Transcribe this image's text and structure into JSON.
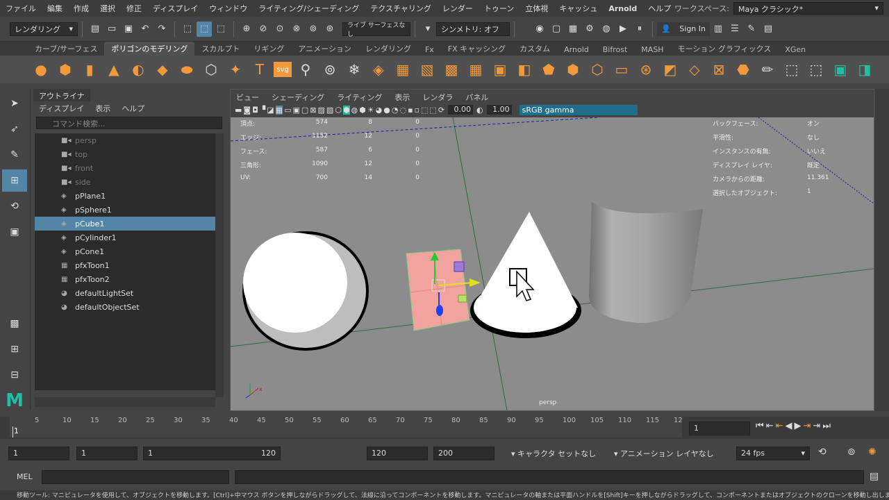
{
  "menubar": {
    "items": [
      "ファイル",
      "編集",
      "作成",
      "選択",
      "修正",
      "ディスプレイ",
      "ウィンドウ",
      "ライティング/シェーディング",
      "テクスチャリング",
      "レンダー",
      "トゥーン",
      "立体視",
      "キャッシュ",
      "Arnold",
      "ヘルプ"
    ],
    "workspace_label": "ワークスペース:",
    "workspace_value": "Maya クラシック*"
  },
  "statusline": {
    "mode": "レンダリング",
    "live_surface": "ライブ サーフェスなし",
    "symmetry": "シンメトリ: オフ",
    "sign_in": "Sign In"
  },
  "shelf": {
    "tabs": [
      "カーブ/サーフェス",
      "ポリゴンのモデリング",
      "スカルプト",
      "リギング",
      "アニメーション",
      "レンダリング",
      "Fx",
      "FX キャッシング",
      "カスタム",
      "Arnold",
      "Bifrost",
      "MASH",
      "モーション グラフィックス",
      "XGen"
    ],
    "active_tab": "ポリゴンのモデリング",
    "svg_label": "svg"
  },
  "outliner": {
    "title": "アウトライナ",
    "menu": [
      "ディスプレイ",
      "表示",
      "ヘルプ"
    ],
    "search_placeholder": "コマンド検索...",
    "items": [
      {
        "label": "persp",
        "icon": "camera-icon",
        "dim": true
      },
      {
        "label": "top",
        "icon": "camera-icon",
        "dim": true
      },
      {
        "label": "front",
        "icon": "camera-icon",
        "dim": true
      },
      {
        "label": "side",
        "icon": "camera-icon",
        "dim": true
      },
      {
        "label": "pPlane1",
        "icon": "mesh-icon",
        "dim": false
      },
      {
        "label": "pSphere1",
        "icon": "mesh-icon",
        "dim": false
      },
      {
        "label": "pCube1",
        "icon": "mesh-icon",
        "dim": false,
        "selected": true
      },
      {
        "label": "pCylinder1",
        "icon": "mesh-icon",
        "dim": false
      },
      {
        "label": "pCone1",
        "icon": "mesh-icon",
        "dim": false
      },
      {
        "label": "pfxToon1",
        "icon": "toon-icon",
        "dim": false
      },
      {
        "label": "pfxToon2",
        "icon": "toon-icon",
        "dim": false
      },
      {
        "label": "defaultLightSet",
        "icon": "set-icon",
        "dim": false
      },
      {
        "label": "defaultObjectSet",
        "icon": "set-icon",
        "dim": false
      }
    ]
  },
  "viewport": {
    "menu": [
      "ビュー",
      "シェーディング",
      "ライティング",
      "表示",
      "レンダラ",
      "パネル"
    ],
    "exposure": "0.00",
    "gamma": "1.00",
    "color_management": "sRGB gamma",
    "camera_label": "persp",
    "hud_left": [
      {
        "label": "頂点:",
        "a": "574",
        "b": "8",
        "c": "0"
      },
      {
        "label": "エッジ:",
        "a": "1152",
        "b": "12",
        "c": "0"
      },
      {
        "label": "フェース:",
        "a": "587",
        "b": "6",
        "c": "0"
      },
      {
        "label": "三角形:",
        "a": "1090",
        "b": "12",
        "c": "0"
      },
      {
        "label": "UV:",
        "a": "700",
        "b": "14",
        "c": "0"
      }
    ],
    "hud_right": [
      {
        "label": "バックフェース:",
        "value": "オン"
      },
      {
        "label": "平滑性:",
        "value": "なし"
      },
      {
        "label": "インスタンスの有無:",
        "value": "いいえ"
      },
      {
        "label": "ディスプレイ レイヤ:",
        "value": "既定"
      },
      {
        "label": "カメラからの距離:",
        "value": "11.361"
      },
      {
        "label": "選択したオブジェクト:",
        "value": "1"
      }
    ]
  },
  "timeslider": {
    "ticks": [
      "5",
      "10",
      "15",
      "20",
      "25",
      "30",
      "35",
      "40",
      "45",
      "50",
      "55",
      "60",
      "65",
      "70",
      "75",
      "80",
      "85",
      "90",
      "95",
      "100",
      "105",
      "110",
      "115",
      "12"
    ],
    "start_marker": "1",
    "current_frame": "1"
  },
  "range": {
    "start": "1",
    "playback_start": "1",
    "range_min": "1",
    "range_max": "120",
    "playback_end": "120",
    "end": "200",
    "character_set": "キャラクタ セットなし",
    "anim_layer": "アニメーション レイヤなし",
    "fps": "24 fps"
  },
  "cmdline": {
    "lang": "MEL"
  },
  "helpline": {
    "text": "移動ツール: マニピュレータを使用して、オブジェクトを移動します。[Ctrl]+中マウス ボタンを押しながらドラッグして、法線に沿ってコンポーネントを移動します。マニピュレータの軸または平面ハンドルを[Shift]キーを押しながらドラッグして、コンポーネントまたはオブジェクトのクローンを移動し出します。"
  }
}
